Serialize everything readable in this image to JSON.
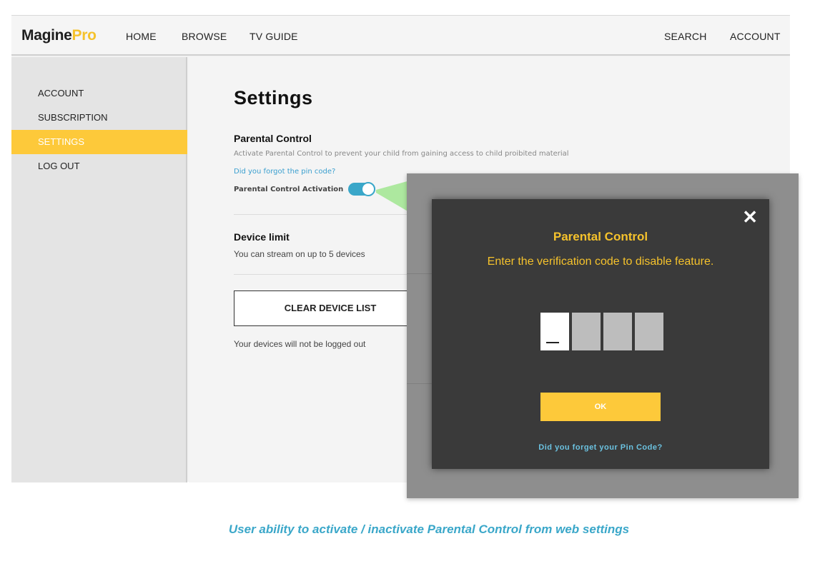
{
  "header": {
    "logo_main": "Magine",
    "logo_accent": "Pro",
    "nav": [
      "HOME",
      "BROWSE",
      "TV GUIDE"
    ],
    "search": "SEARCH",
    "account": "ACCOUNT"
  },
  "sidebar": {
    "items": [
      {
        "label": "ACCOUNT"
      },
      {
        "label": "SUBSCRIPTION"
      },
      {
        "label": "SETTINGS"
      },
      {
        "label": "LOG OUT"
      }
    ],
    "active": "SETTINGS"
  },
  "settings": {
    "title": "Settings",
    "parental": {
      "heading": "Parental Control",
      "description": "Activate Parental Control to prevent your child from gaining access to child proibited material",
      "forgot_link": "Did you forgot the pin code?",
      "activation_label": "Parental Control Activation",
      "toggle_on": true
    },
    "device": {
      "heading": "Device limit",
      "description": "You can stream on up to 5 devices",
      "clear_button": "CLEAR DEVICE LIST",
      "note": "Your devices will not be logged out"
    }
  },
  "dialog": {
    "title": "Parental Control",
    "subtitle": "Enter the verification code to disable  feature.",
    "pin_length": 4,
    "ok_button": "OK",
    "forgot_link": "Did you forget your Pin Code?",
    "close_icon": "close-icon"
  },
  "caption": "User ability to activate / inactivate Parental Control from web settings",
  "colors": {
    "accent_yellow": "#fdc93a",
    "accent_blue": "#3aa7c9",
    "dialog_bg": "#3a3a3a"
  }
}
